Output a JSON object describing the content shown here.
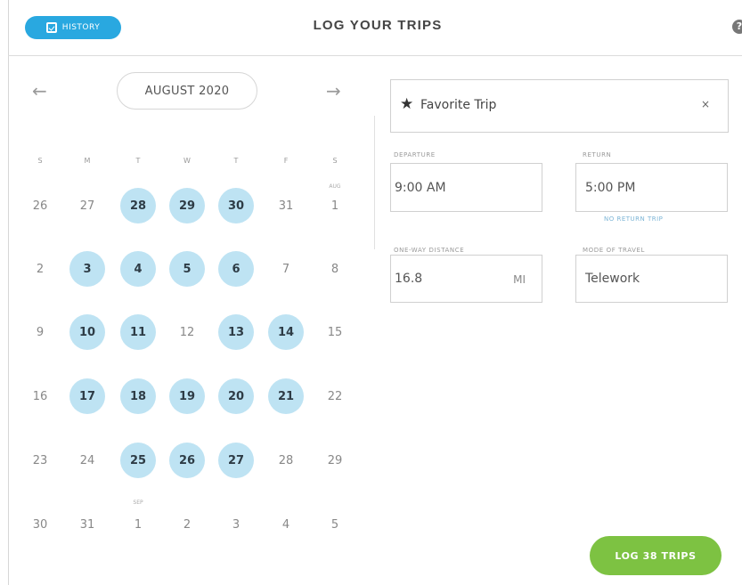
{
  "header": {
    "history_label": "HISTORY",
    "title": "LOG YOUR TRIPS"
  },
  "calendar": {
    "month_label": "AUGUST 2020",
    "weekdays": [
      "S",
      "M",
      "T",
      "W",
      "T",
      "F",
      "S"
    ],
    "weeks": [
      [
        {
          "d": "26",
          "l": false
        },
        {
          "d": "27",
          "l": false
        },
        {
          "d": "28",
          "l": true
        },
        {
          "d": "29",
          "l": true
        },
        {
          "d": "30",
          "l": true
        },
        {
          "d": "31",
          "l": false
        },
        {
          "d": "1",
          "l": false
        }
      ],
      [
        {
          "d": "2",
          "l": false
        },
        {
          "d": "3",
          "l": true
        },
        {
          "d": "4",
          "l": true
        },
        {
          "d": "5",
          "l": true
        },
        {
          "d": "6",
          "l": true
        },
        {
          "d": "7",
          "l": false
        },
        {
          "d": "8",
          "l": false
        }
      ],
      [
        {
          "d": "9",
          "l": false
        },
        {
          "d": "10",
          "l": true
        },
        {
          "d": "11",
          "l": true
        },
        {
          "d": "12",
          "l": false
        },
        {
          "d": "13",
          "l": true
        },
        {
          "d": "14",
          "l": true
        },
        {
          "d": "15",
          "l": false
        }
      ],
      [
        {
          "d": "16",
          "l": false
        },
        {
          "d": "17",
          "l": true
        },
        {
          "d": "18",
          "l": true
        },
        {
          "d": "19",
          "l": true
        },
        {
          "d": "20",
          "l": true
        },
        {
          "d": "21",
          "l": true
        },
        {
          "d": "22",
          "l": false
        }
      ],
      [
        {
          "d": "23",
          "l": false
        },
        {
          "d": "24",
          "l": false
        },
        {
          "d": "25",
          "l": true
        },
        {
          "d": "26",
          "l": true
        },
        {
          "d": "27",
          "l": true
        },
        {
          "d": "28",
          "l": false
        },
        {
          "d": "29",
          "l": false
        }
      ],
      [
        {
          "d": "30",
          "l": false
        },
        {
          "d": "31",
          "l": false
        },
        {
          "d": "1",
          "l": false
        },
        {
          "d": "2",
          "l": false
        },
        {
          "d": "3",
          "l": false
        },
        {
          "d": "4",
          "l": false
        },
        {
          "d": "5",
          "l": false
        }
      ]
    ],
    "month_markers": {
      "aug": "AUG",
      "sep": "SEP"
    }
  },
  "trip": {
    "favorite_label": "Favorite Trip",
    "clear_symbol": "×",
    "departure_label": "DEPARTURE",
    "departure_value": "9:00 AM",
    "return_label": "RETURN",
    "return_value": "5:00 PM",
    "no_return_label": "NO RETURN TRIP",
    "distance_label": "ONE-WAY DISTANCE",
    "distance_value": "16.8",
    "distance_unit": "MI",
    "mode_label": "MODE OF TRAVEL",
    "mode_value": "Telework"
  },
  "actions": {
    "log_button": "LOG 38 TRIPS"
  },
  "icons": {
    "help": "?",
    "prev": "←",
    "next": "→",
    "star": "★"
  },
  "colors": {
    "accent_blue": "#29a8e0",
    "logged_day": "#bee3f3",
    "log_green": "#7dc242"
  }
}
